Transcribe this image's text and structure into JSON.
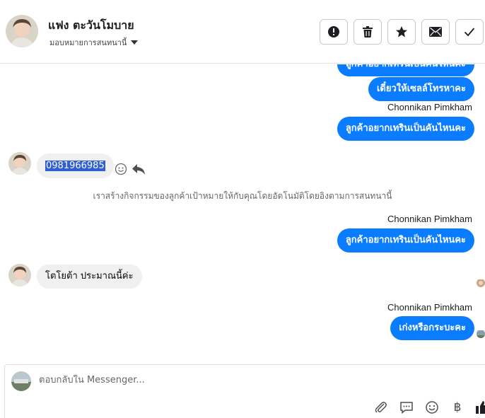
{
  "header": {
    "contact_name": "แฟง ตะวันโมบาย",
    "assign_label": "มอบหมายการสนทนานี้",
    "actions": [
      {
        "name": "report-button",
        "icon": "alert-icon"
      },
      {
        "name": "delete-button",
        "icon": "trash-icon"
      },
      {
        "name": "star-button",
        "icon": "star-icon"
      },
      {
        "name": "mark-unread-button",
        "icon": "envelope-icon"
      },
      {
        "name": "mark-done-button",
        "icon": "check-icon"
      }
    ]
  },
  "thread": {
    "outgoing_partial": "ลูกค้าอยากเทรินเป็นคันไหนคะ",
    "outgoing_1": "เดี๋ยวให้เซลล์โทรหาคะ",
    "sender_1": "Chonnikan Pimkham",
    "outgoing_2": "ลูกค้าอยากเทรินเป็นคันไหนคะ",
    "incoming_phone": "0981966985",
    "system_note": "เราสร้างกิจกรรมของลูกค้าเป้าหมายให้กับคุณโดยอัตโนมัติโดยอิงตามการสนทนานี้",
    "sender_2": "Chonnikan Pimkham",
    "outgoing_3": "ลูกค้าอยากเทรินเป็นคันไหนคะ",
    "incoming_2": "โตโยต้า ประมาณนี้ค่ะ",
    "sender_3": "Chonnikan Pimkham",
    "outgoing_4": "เก่งหรือกระบะคะ"
  },
  "composer": {
    "placeholder": "ตอบกลับใน Messenger...",
    "tools": [
      "paperclip-icon",
      "saved-reply-icon",
      "emoji-icon",
      "baht-icon",
      "thumbs-up-icon"
    ],
    "baht_symbol": "฿"
  },
  "colors": {
    "accent": "#0a7cff",
    "incoming_bg": "#f0f0f0",
    "border": "#dddfe2"
  }
}
